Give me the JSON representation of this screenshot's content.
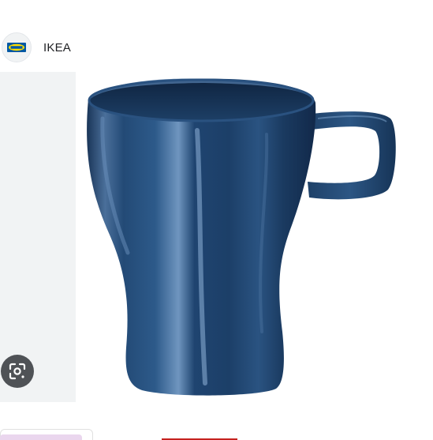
{
  "source": {
    "favicon_icon": "ikea-logo-icon",
    "name": "IKEA"
  },
  "image": {
    "subject": "mug-image",
    "mug_color": "#1d3f66"
  },
  "controls": {
    "lens_icon": "google-lens-icon"
  },
  "colors": {
    "panel_bg": "#f1f3f4",
    "lens_bg": "#4f5256",
    "ikea_blue": "#0058a3",
    "ikea_yellow": "#ffdb00"
  }
}
